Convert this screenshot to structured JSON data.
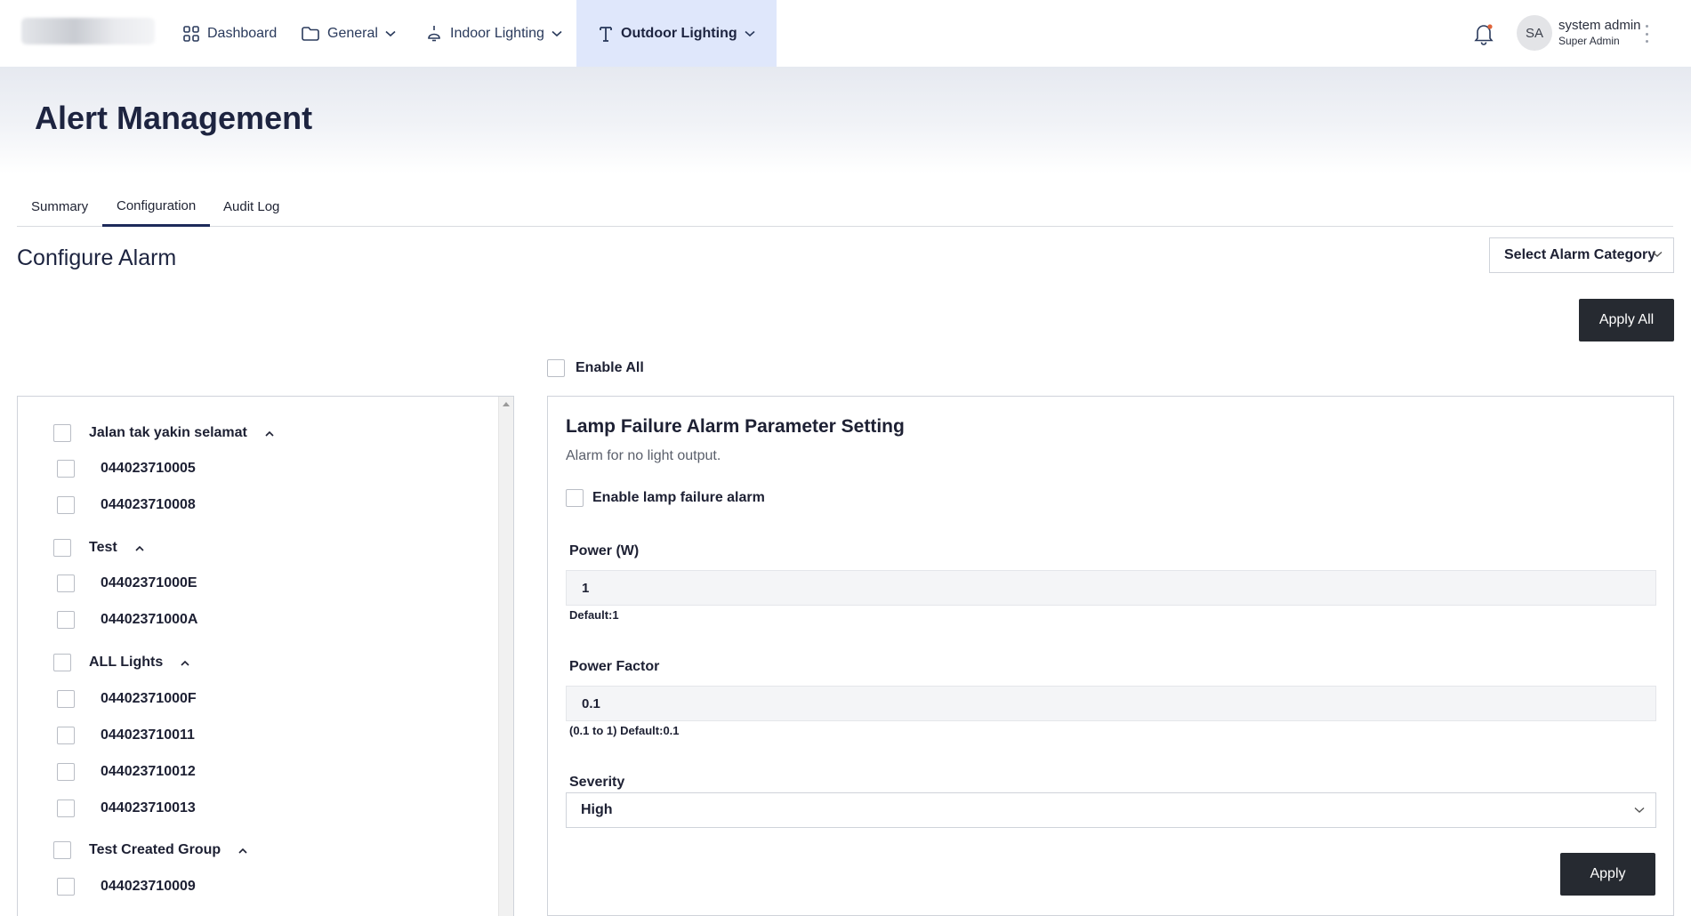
{
  "nav": {
    "items": [
      {
        "label": "Dashboard",
        "icon": "grid-icon"
      },
      {
        "label": "General",
        "icon": "folder-icon"
      },
      {
        "label": "Indoor Lighting",
        "icon": "ceiling-lamp-icon"
      },
      {
        "label": "Outdoor Lighting",
        "icon": "street-lamp-icon",
        "active": true
      }
    ],
    "user": {
      "initials": "SA",
      "name": "system admin",
      "role": "Super Admin"
    },
    "accent_active_bg": "#dfe7fb"
  },
  "page": {
    "title": "Alert Management"
  },
  "tabs": [
    {
      "label": "Summary"
    },
    {
      "label": "Configuration",
      "active": true
    },
    {
      "label": "Audit Log"
    }
  ],
  "config": {
    "title": "Configure Alarm",
    "select_category": "Select Alarm Category",
    "apply_all": "Apply All",
    "enable_all": "Enable All"
  },
  "tree": {
    "groups": [
      {
        "name": "Jalan tak yakin selamat",
        "children": [
          "044023710005",
          "044023710008"
        ]
      },
      {
        "name": "Test",
        "children": [
          "04402371000E",
          "04402371000A"
        ]
      },
      {
        "name": "ALL Lights",
        "children": [
          "04402371000F",
          "044023710011",
          "044023710012",
          "044023710013"
        ]
      },
      {
        "name": "Test Created Group",
        "children": [
          "044023710009"
        ]
      }
    ]
  },
  "params": {
    "title": "Lamp Failure Alarm Parameter Setting",
    "description": "Alarm for no light output.",
    "enable_label": "Enable lamp failure alarm",
    "power": {
      "label": "Power (W)",
      "value": "1",
      "hint": "Default:1"
    },
    "power_factor": {
      "label": "Power Factor",
      "value": "0.1",
      "hint": "(0.1 to 1) Default:0.1"
    },
    "severity": {
      "label": "Severity",
      "value": "High"
    },
    "apply": "Apply"
  },
  "colors": {
    "button_dark": "#262a31",
    "title_navy": "#1d2440",
    "tab_underline": "#1d2a5a"
  }
}
